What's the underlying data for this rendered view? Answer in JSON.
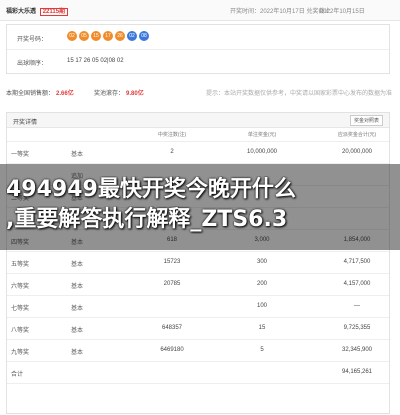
{
  "topbar": {
    "brand": "福彩大乐透",
    "brand_num": "22115期",
    "open_time": "开奖时间：2022年10月17日 兑奖截止",
    "deadline": "2022年10月15日"
  },
  "draw": {
    "numbers_label": "开奖号码：",
    "balls": [
      {
        "num": "02",
        "color": "orange"
      },
      {
        "num": "05",
        "color": "orange"
      },
      {
        "num": "15",
        "color": "orange"
      },
      {
        "num": "17",
        "color": "orange"
      },
      {
        "num": "26",
        "color": "orange"
      },
      {
        "num": "02",
        "color": "blue"
      },
      {
        "num": "08",
        "color": "blue"
      }
    ],
    "sequence_label": "出球顺序：",
    "sequence": "15 17 26 05 02|08 02"
  },
  "stats": {
    "sales_label": "本期全国销售额：",
    "sales_value": "2.66亿",
    "pool_label": "奖池滚存：",
    "pool_value": "9.80亿",
    "tip": "提示：本站开奖数据仅供参考，中奖请以国家彩票中心发布的数据为准"
  },
  "details": {
    "title": "开奖详情",
    "button": "奖金对照表",
    "headers": {
      "award": "",
      "type": "",
      "count": "中奖注数(注)",
      "prize": "单注奖金(元)",
      "total": "应派奖金合计(元)"
    },
    "rows": [
      {
        "award": "一等奖",
        "type": "基本",
        "count": "2",
        "prize": "10,000,000",
        "total": "20,000,000"
      },
      {
        "award": "",
        "type": "追加",
        "count": "",
        "prize": "",
        "total": ""
      },
      {
        "award": "二等奖",
        "type": "基本",
        "count": "",
        "prize": "",
        "total": ""
      },
      {
        "award": "",
        "type": "",
        "count": "",
        "prize": "",
        "total": ""
      },
      {
        "award": "四等奖",
        "type": "基本",
        "count": "618",
        "prize": "3,000",
        "total": "1,854,000"
      },
      {
        "award": "五等奖",
        "type": "基本",
        "count": "15723",
        "prize": "300",
        "total": "4,717,500"
      },
      {
        "award": "六等奖",
        "type": "基本",
        "count": "20785",
        "prize": "200",
        "total": "4,157,000"
      },
      {
        "award": "七等奖",
        "type": "基本",
        "count": "",
        "prize": "100",
        "total": "—"
      },
      {
        "award": "八等奖",
        "type": "基本",
        "count": "648357",
        "prize": "15",
        "total": "9,725,355"
      },
      {
        "award": "九等奖",
        "type": "基本",
        "count": "6469180",
        "prize": "5",
        "total": "32,345,900"
      },
      {
        "award": "合计",
        "type": "",
        "count": "",
        "prize": "",
        "total": "94,165,261"
      }
    ]
  },
  "overlay": {
    "line1": "494949最快开奖今晚开什么",
    "line2": ",重要解答执行解释_ZTS6.3"
  }
}
